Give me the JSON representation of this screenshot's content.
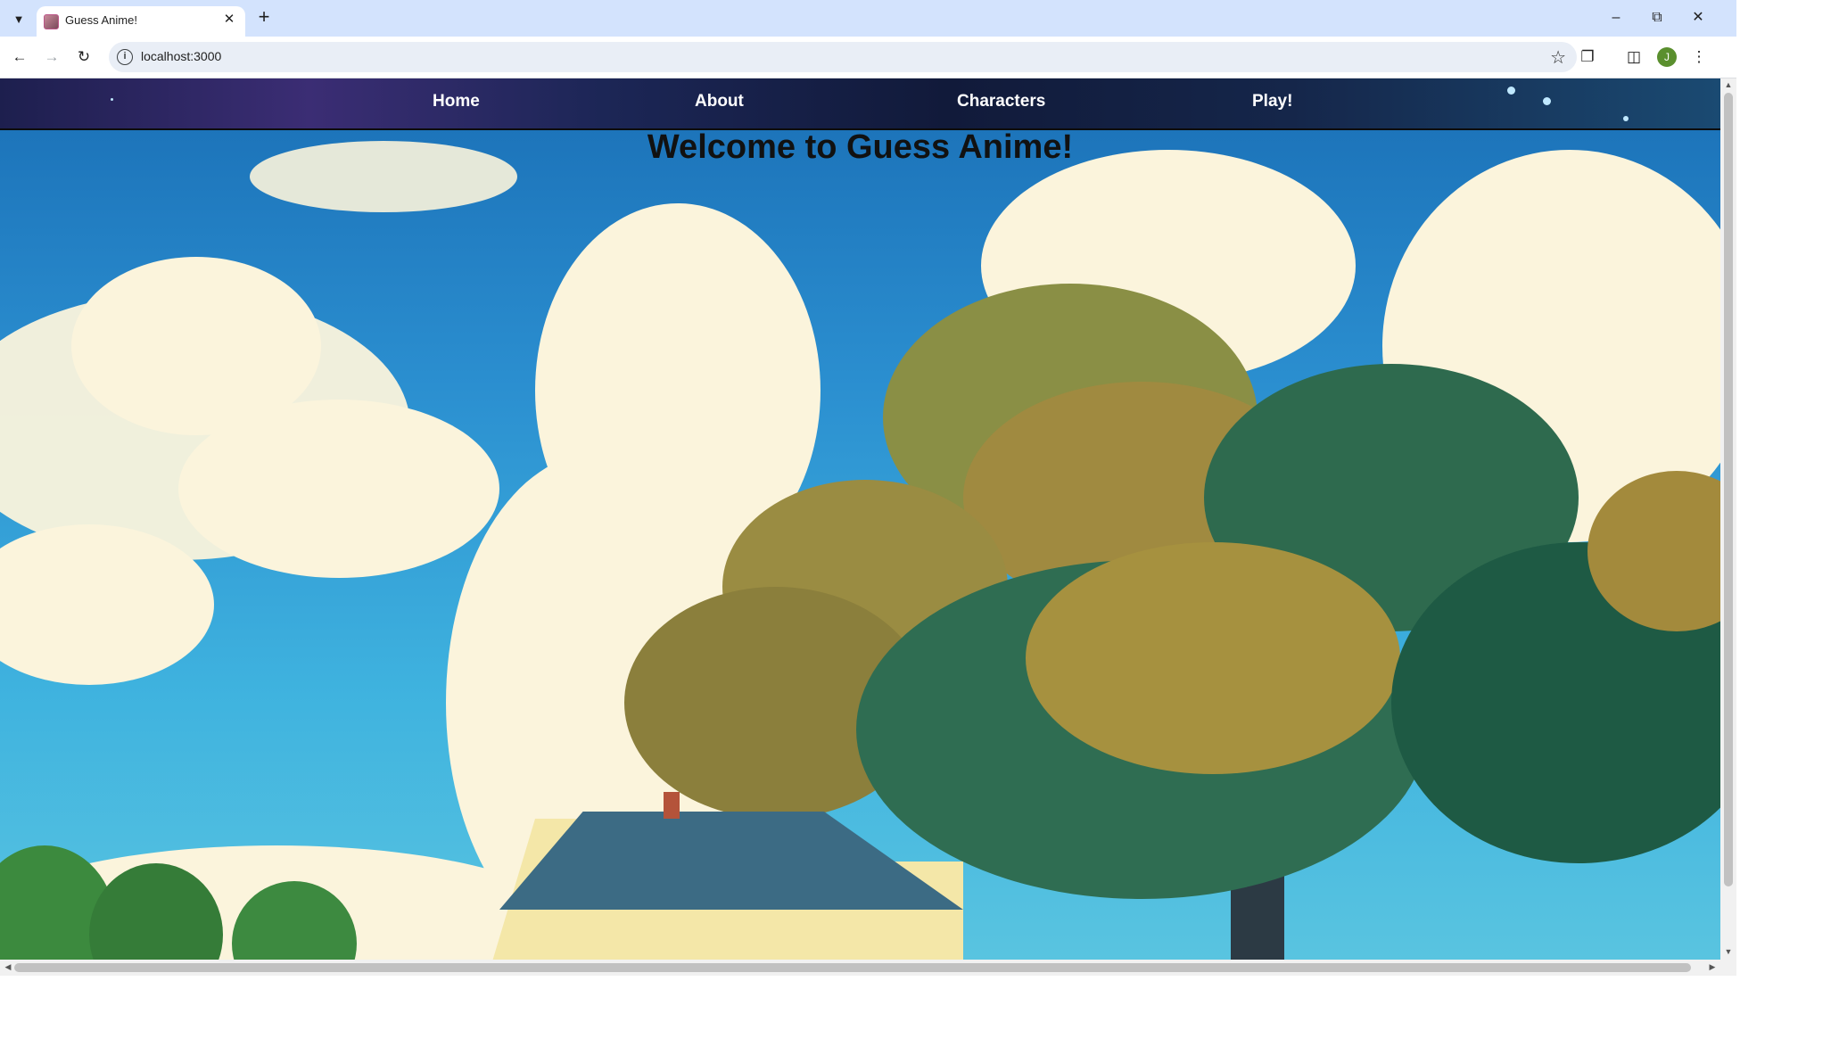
{
  "browser": {
    "tab_title": "Guess Anime!",
    "url": "localhost:3000",
    "profile_initial": "J"
  },
  "site": {
    "nav": [
      "Home",
      "About",
      "Characters",
      "Play!"
    ],
    "heading": "Welcome to Guess Anime!"
  },
  "icons": {
    "tab_search": "chevron-down-icon",
    "close": "close-icon",
    "new_tab": "plus-icon",
    "back": "back-arrow-icon",
    "forward": "forward-arrow-icon",
    "reload": "reload-icon",
    "site_info": "info-icon",
    "bookmark": "star-icon",
    "extensions": "puzzle-icon",
    "side_panel": "side-panel-icon",
    "menu": "kebab-menu-icon"
  },
  "colors": {
    "tab_strip": "#d3e3fd",
    "nav_bar": "#111a3a",
    "heading_text": "#111111"
  }
}
